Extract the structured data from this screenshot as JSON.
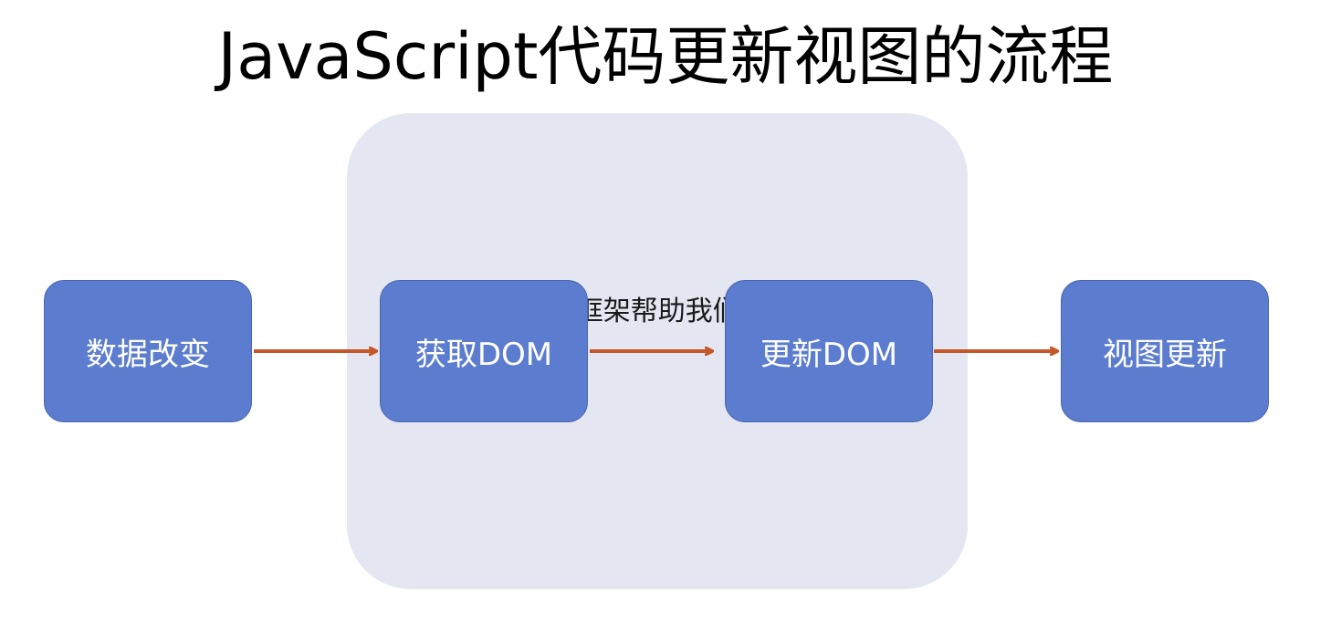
{
  "title": "JavaScript代码更新视图的流程",
  "region": {
    "label": "VUE框架帮助我们实现",
    "color": "#e4e7f2"
  },
  "nodes": [
    {
      "label": "数据改变"
    },
    {
      "label": "获取DOM"
    },
    {
      "label": "更新DOM"
    },
    {
      "label": "视图更新"
    }
  ],
  "colors": {
    "node_fill": "#5b7ccf",
    "node_text": "#ffffff",
    "arrow": "#c4562a"
  }
}
